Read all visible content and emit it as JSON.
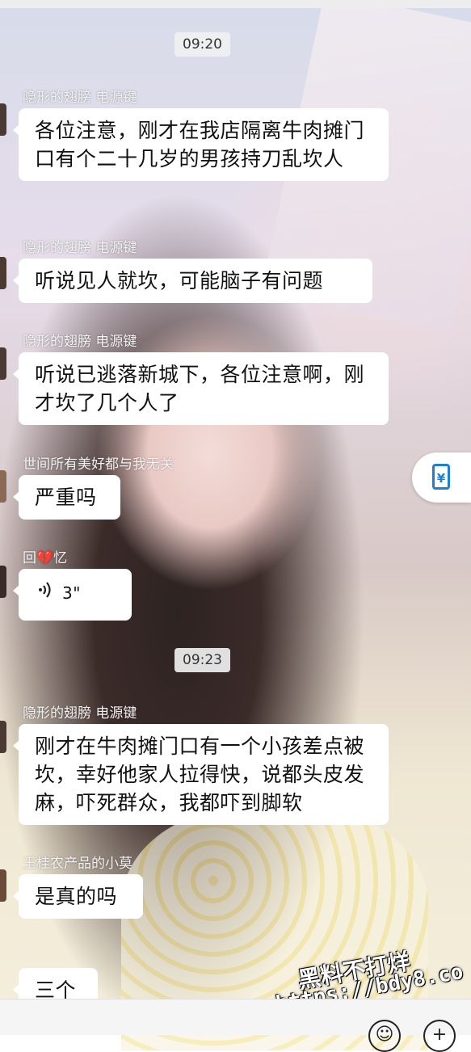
{
  "messages": [
    {
      "type": "time",
      "text": "09:20"
    },
    {
      "type": "msg",
      "sender": "隐形的翅膀  电源键",
      "text": "各位注意，刚才在我店隔离牛肉摊门口有个二十几岁的男孩持刀乱坎人"
    },
    {
      "type": "msg",
      "sender": "隐形的翅膀  电源键",
      "text": "听说见人就坎，可能脑子有问题"
    },
    {
      "type": "msg",
      "sender": "隐形的翅膀  电源键",
      "text": "听说已逃落新城下，各位注意啊，刚才坎了几个人了"
    },
    {
      "type": "msg",
      "sender": "世间所有美好都与我无关",
      "text": "严重吗"
    },
    {
      "type": "voice",
      "sender": "回💔忆",
      "duration": "3\""
    },
    {
      "type": "time",
      "text": "09:23"
    },
    {
      "type": "msg",
      "sender": "隐形的翅膀  电源键",
      "text": "刚才在牛肉摊门口有一个小孩差点被坎，幸好他家人拉得快，说都头皮发麻，吓死群众，我都吓到脚软"
    },
    {
      "type": "msg",
      "sender": "玉桂农产品的小莫",
      "text": "是真的吗"
    },
    {
      "type": "msg",
      "sender": "",
      "text": "三个"
    }
  ],
  "small_count": "8",
  "side_button": {
    "icon": "yuan-pay-icon",
    "glyph": "¥"
  },
  "watermark": {
    "line1": "黑料不打烊",
    "line2": "https://bdy8.co"
  },
  "bottom": {
    "emoji_glyph": "☺",
    "plus_glyph": "+"
  },
  "colors": {
    "bubble": "#ffffff",
    "accent": "#1a7fd6"
  }
}
